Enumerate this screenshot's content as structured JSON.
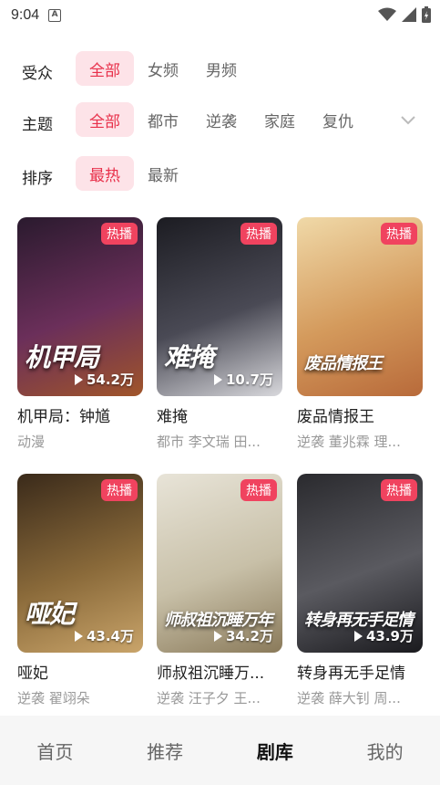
{
  "status_bar": {
    "time": "9:04",
    "notif_glyph": "A",
    "icons": [
      "wifi-icon",
      "signal-icon",
      "battery-icon"
    ]
  },
  "filters": [
    {
      "label": "受众",
      "options": [
        "全部",
        "女频",
        "男频"
      ],
      "selected": 0
    },
    {
      "label": "主题",
      "options": [
        "全部",
        "都市",
        "逆袭",
        "家庭",
        "复仇"
      ],
      "selected": 0
    },
    {
      "label": "排序",
      "options": [
        "最热",
        "最新"
      ],
      "selected": 0
    }
  ],
  "cards": [
    {
      "title": "机甲局：钟馗",
      "subtitle": "动漫",
      "badge": "热播",
      "views": "54.2万",
      "poster_text": "机甲局",
      "colors": [
        "#2a1a2e",
        "#6b2f5a",
        "#a0552a"
      ]
    },
    {
      "title": "难掩",
      "subtitle": "都市 李文瑞 田...",
      "badge": "热播",
      "views": "10.7万",
      "poster_text": "难掩",
      "colors": [
        "#1c1c22",
        "#4a4a55",
        "#d8d8dc"
      ]
    },
    {
      "title": "废品情报王",
      "subtitle": "逆袭 董兆霖 理...",
      "badge": "热播",
      "views": "",
      "poster_text": "废品情报王",
      "colors": [
        "#f0d9a8",
        "#d49a5c",
        "#b86a3a"
      ]
    },
    {
      "title": "哑妃",
      "subtitle": "逆袭 翟翊朵",
      "badge": "热播",
      "views": "43.4万",
      "poster_text": "哑妃",
      "colors": [
        "#3a2a1a",
        "#8a6a3a",
        "#c9a46a"
      ]
    },
    {
      "title": "师叔祖沉睡万...",
      "subtitle": "逆袭 汪子夕 王...",
      "badge": "热播",
      "views": "34.2万",
      "poster_text": "师叔祖沉睡万年",
      "colors": [
        "#e8e4d8",
        "#c8c0a8",
        "#8a7a5a"
      ]
    },
    {
      "title": "转身再无手足情",
      "subtitle": "逆袭 薛大钊 周...",
      "badge": "热播",
      "views": "43.9万",
      "poster_text": "转身再无手足情",
      "colors": [
        "#2a2a2e",
        "#5a5a60",
        "#1a1a1e"
      ]
    }
  ],
  "bottom_nav": {
    "items": [
      "首页",
      "推荐",
      "剧库",
      "我的"
    ],
    "active": 2
  }
}
